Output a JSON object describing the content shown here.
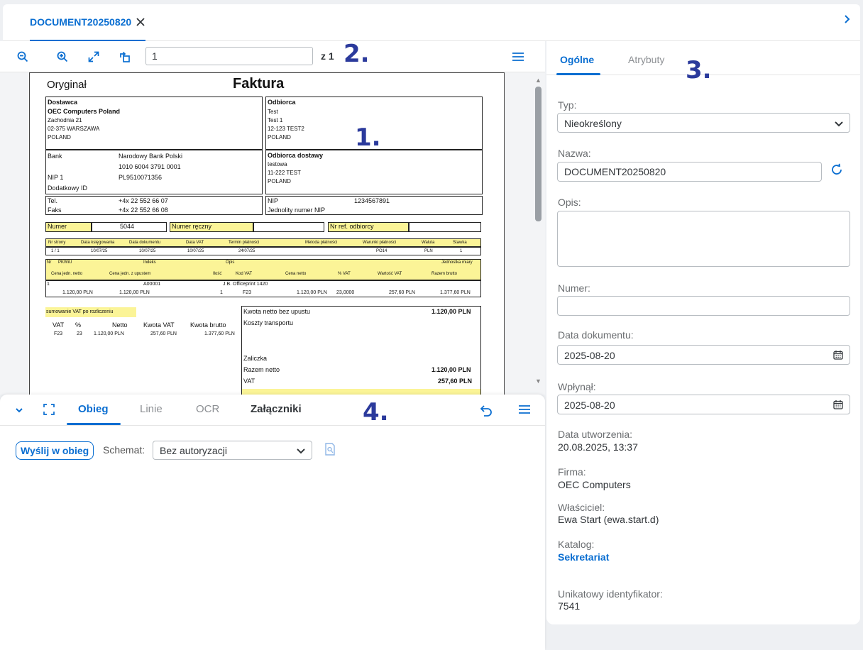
{
  "tab": {
    "title": "DOCUMENT20250820"
  },
  "viewer": {
    "page_value": "1",
    "page_of": "z 1"
  },
  "overlay_numbers": [
    "1.",
    "2.",
    "3.",
    "4."
  ],
  "invoice": {
    "original": "Oryginał",
    "title": "Faktura",
    "supplier_heading": "Dostawca",
    "supplier_name": "OEC Computers Poland",
    "supplier_street": "Zachodnia 21",
    "supplier_city": "02-375 WARSZAWA",
    "supplier_country": "POLAND",
    "recipient_heading": "Odbiorca",
    "recipient_name": "Test",
    "recipient_street": "Test 1",
    "recipient_city": "12-123 TEST2",
    "recipient_country": "POLAND",
    "bank_label": "Bank",
    "bank_name": "Narodowy Bank Polski",
    "bank_account": "1010 6004 3791 0001",
    "nip_label": "NIP 1",
    "nip_value": "PL9510071356",
    "extra_id": "Dodatkowy ID",
    "delivery_heading": "Odbiorca dostawy",
    "delivery_name": "testowa",
    "delivery_city": "11-222 TEST",
    "delivery_country": "POLAND",
    "tel_label": "Tel.",
    "tel_value": "+4x 22 552 66 07",
    "fax_label": "Faks",
    "fax_value": "+4x 22 552 66 08",
    "nip2_label": "NIP",
    "nip2_value": "1234567891",
    "nip_unique": "Jednolity numer NIP",
    "numer_label": "Numer",
    "numer_value": "5044",
    "numer_reczny": "Numer ręczny",
    "nr_ref": "Nr ref. odbiorcy",
    "hdr_cols": [
      "Nr strony",
      "Data księgowania",
      "Data dokumentu",
      "Data VAT",
      "Termin płatności",
      "Metoda płatności",
      "Warunki płatności",
      "Waluta",
      "Stawka"
    ],
    "hdr_vals": [
      "1 / 1",
      "10/07/25",
      "10/07/25",
      "10/07/25",
      "24/07/25",
      "",
      "PO14",
      "PLN",
      "1"
    ],
    "item_hdr1": [
      "Nr",
      "PKWiU",
      "Indeks",
      "Opis",
      "Jednostka miary"
    ],
    "item_hdr2": [
      "Cena jedn. netto",
      "Cena jedn. z upustem",
      "Ilość",
      "Kod VAT",
      "Cena netto",
      "% VAT",
      "Wartość VAT",
      "Razem brutto"
    ],
    "item_row1": [
      "1",
      "A00001",
      "J.B. Officeprint 1420"
    ],
    "item_row2": [
      "1.120,00 PLN",
      "1.120,00 PLN",
      "1",
      "F23",
      "1.120,00 PLN",
      "23,0000",
      "257,60 PLN",
      "1.377,60 PLN"
    ],
    "vat_summary_label": "sumowanie VAT po rozliczeniu",
    "vat_cols": [
      "VAT",
      "%",
      "Netto",
      "Kwota VAT",
      "Kwota brutto"
    ],
    "vat_row": [
      "F23",
      "23",
      "1.120,00 PLN",
      "257,60 PLN",
      "1.377,60 PLN"
    ],
    "tot_netto_label": "Kwota netto bez upustu",
    "tot_netto_value": "1.120,00 PLN",
    "transport_label": "Koszty transportu",
    "zaliczka_label": "Zaliczka",
    "razem_netto_label": "Razem netto",
    "razem_netto_value": "1.120,00 PLN",
    "vat_label": "VAT",
    "vat_value": "257,60 PLN"
  },
  "bottom": {
    "tabs": [
      "Obieg",
      "Linie",
      "OCR",
      "Załączniki"
    ],
    "send_label": "Wyślij w obieg",
    "schema_label": "Schemat:",
    "schema_value": "Bez autoryzacji"
  },
  "right": {
    "tabs": [
      "Ogólne",
      "Atrybuty"
    ],
    "typ_label": "Typ:",
    "typ_value": "Nieokreślony",
    "nazwa_label": "Nazwa:",
    "nazwa_value": "DOCUMENT20250820",
    "opis_label": "Opis:",
    "opis_value": "",
    "numer_label": "Numer:",
    "numer_value": "",
    "data_dok_label": "Data dokumentu:",
    "data_dok_value": "2025-08-20",
    "wplynal_label": "Wpłynął:",
    "wplynal_value": "2025-08-20",
    "data_utw_label": "Data utworzenia:",
    "data_utw_value": "20.08.2025, 13:37",
    "firma_label": "Firma:",
    "firma_value": "OEC Computers",
    "wlasciciel_label": "Właściciel:",
    "wlasciciel_value": "Ewa Start (ewa.start.d)",
    "katalog_label": "Katalog:",
    "katalog_value": "Sekretariat",
    "uid_label": "Unikatowy identyfikator:",
    "uid_value": "7541"
  },
  "colors": {
    "accent": "#0a6ed1",
    "highlight": "#fbf497",
    "overlay_number": "#2b3a9c"
  }
}
